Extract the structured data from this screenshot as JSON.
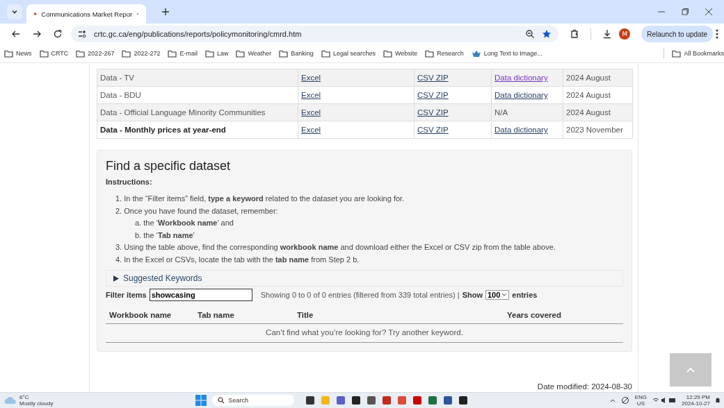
{
  "browser": {
    "tab": {
      "title": "Communications Market Repor",
      "selected": true
    },
    "url": "crtc.gc.ca/eng/publications/reports/policymonitoring/cmrd.htm",
    "avatar": "M",
    "relaunch": "Relaunch to update",
    "bookmarks": [
      {
        "label": "News",
        "kind": "folder"
      },
      {
        "label": "CRTC",
        "kind": "folder"
      },
      {
        "label": "2022-267",
        "kind": "folder"
      },
      {
        "label": "2022-272",
        "kind": "folder"
      },
      {
        "label": "E-mail",
        "kind": "folder"
      },
      {
        "label": "Law",
        "kind": "folder"
      },
      {
        "label": "Weather",
        "kind": "folder"
      },
      {
        "label": "Banking",
        "kind": "folder"
      },
      {
        "label": "Legal searches",
        "kind": "folder"
      },
      {
        "label": "Website",
        "kind": "folder"
      },
      {
        "label": "Research",
        "kind": "folder"
      },
      {
        "label": "Long Text to Image...",
        "kind": "site"
      }
    ],
    "all_bookmarks": "All Bookmarks"
  },
  "datasets": [
    {
      "name": "Data - TV",
      "bold": false,
      "excel": "Excel",
      "csv": "CSV ZIP",
      "dictionary": {
        "text": "Data dictionary",
        "kind": "link",
        "visited": true
      },
      "date": "2024 August"
    },
    {
      "name": "Data - BDU",
      "bold": false,
      "excel": "Excel",
      "csv": "CSV ZIP",
      "dictionary": {
        "text": "Data dictionary",
        "kind": "link",
        "visited": false
      },
      "date": "2024 August"
    },
    {
      "name": "Data - Official Language Minority Communities",
      "bold": false,
      "excel": "Excel",
      "csv": "CSV ZIP",
      "dictionary": {
        "text": "N/A",
        "kind": "text"
      },
      "date": "2024 August"
    },
    {
      "name": "Data - Monthly prices at year-end",
      "bold": true,
      "excel": "Excel",
      "csv": "CSV ZIP",
      "dictionary": {
        "text": "Data dictionary",
        "kind": "link",
        "visited": false
      },
      "date": "2023 November"
    }
  ],
  "finder": {
    "heading": "Find a specific dataset",
    "instructions_label": "Instructions:",
    "steps": [
      {
        "number": "1.",
        "text": "In the “Filter items” field, **type a keyword** related to the dataset you are looking for."
      },
      {
        "number": "2.",
        "text": "Once you have found the dataset, remember:",
        "children": [
          {
            "number": "a.",
            "text": "the ‘**Workbook name**’ and"
          },
          {
            "number": "b.",
            "text": "the ‘**Tab name**’"
          }
        ]
      },
      {
        "number": "3.",
        "text": "Using the table above, find the corresponding **workbook name** and download either the Excel or CSV zip from the table above."
      },
      {
        "number": "4.",
        "text": "In the Excel or CSVs, locate the tab with the **tab name** from Step 2 b."
      }
    ],
    "suggested": {
      "label": "Suggested Keywords",
      "expanded": false
    },
    "filter_label": "Filter items",
    "filter_value": "showcasing",
    "info": "Showing 0 to 0 of 0 entries (filtered from 339 total entries) |",
    "show_label": "Show",
    "show_value": "100",
    "entries_label": "entries",
    "columns": [
      "Workbook name",
      "Tab name",
      "Title",
      "Years covered"
    ],
    "empty_message": "Can’t find what you’re looking for? Try another keyword."
  },
  "date_modified": "Date modified: 2024-08-30",
  "taskbar": {
    "temperature": "6°C",
    "weather": "Mostly cloudy",
    "search": "Search",
    "language": "ENG",
    "region": "US",
    "time": "12:29 PM",
    "date": "2024-10-27"
  }
}
